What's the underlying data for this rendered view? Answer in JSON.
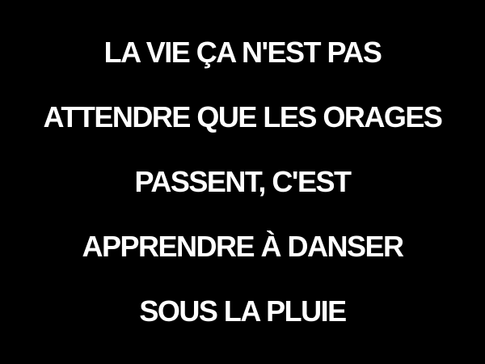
{
  "quote": {
    "lines": [
      "LA VIE ÇA N'EST PAS",
      "ATTENDRE QUE LES ORAGES",
      "PASSENT, C'EST",
      "APPRENDRE À DANSER",
      "SOUS LA PLUIE"
    ],
    "text_color": "#ffffff",
    "background_color": "#000000"
  }
}
